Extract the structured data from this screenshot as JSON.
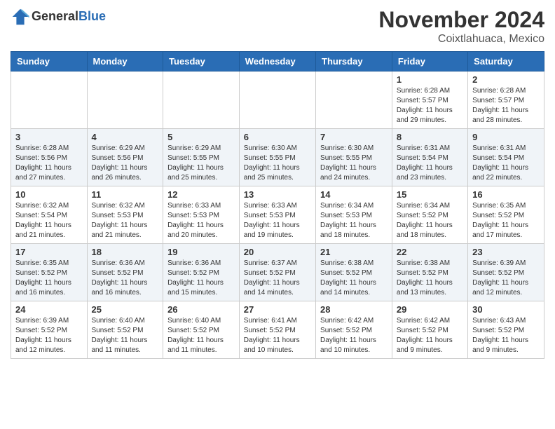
{
  "logo": {
    "general": "General",
    "blue": "Blue"
  },
  "title": "November 2024",
  "location": "Coixtlahuaca, Mexico",
  "headers": [
    "Sunday",
    "Monday",
    "Tuesday",
    "Wednesday",
    "Thursday",
    "Friday",
    "Saturday"
  ],
  "weeks": [
    [
      {
        "day": "",
        "info": ""
      },
      {
        "day": "",
        "info": ""
      },
      {
        "day": "",
        "info": ""
      },
      {
        "day": "",
        "info": ""
      },
      {
        "day": "",
        "info": ""
      },
      {
        "day": "1",
        "info": "Sunrise: 6:28 AM\nSunset: 5:57 PM\nDaylight: 11 hours and 29 minutes."
      },
      {
        "day": "2",
        "info": "Sunrise: 6:28 AM\nSunset: 5:57 PM\nDaylight: 11 hours and 28 minutes."
      }
    ],
    [
      {
        "day": "3",
        "info": "Sunrise: 6:28 AM\nSunset: 5:56 PM\nDaylight: 11 hours and 27 minutes."
      },
      {
        "day": "4",
        "info": "Sunrise: 6:29 AM\nSunset: 5:56 PM\nDaylight: 11 hours and 26 minutes."
      },
      {
        "day": "5",
        "info": "Sunrise: 6:29 AM\nSunset: 5:55 PM\nDaylight: 11 hours and 25 minutes."
      },
      {
        "day": "6",
        "info": "Sunrise: 6:30 AM\nSunset: 5:55 PM\nDaylight: 11 hours and 25 minutes."
      },
      {
        "day": "7",
        "info": "Sunrise: 6:30 AM\nSunset: 5:55 PM\nDaylight: 11 hours and 24 minutes."
      },
      {
        "day": "8",
        "info": "Sunrise: 6:31 AM\nSunset: 5:54 PM\nDaylight: 11 hours and 23 minutes."
      },
      {
        "day": "9",
        "info": "Sunrise: 6:31 AM\nSunset: 5:54 PM\nDaylight: 11 hours and 22 minutes."
      }
    ],
    [
      {
        "day": "10",
        "info": "Sunrise: 6:32 AM\nSunset: 5:54 PM\nDaylight: 11 hours and 21 minutes."
      },
      {
        "day": "11",
        "info": "Sunrise: 6:32 AM\nSunset: 5:53 PM\nDaylight: 11 hours and 21 minutes."
      },
      {
        "day": "12",
        "info": "Sunrise: 6:33 AM\nSunset: 5:53 PM\nDaylight: 11 hours and 20 minutes."
      },
      {
        "day": "13",
        "info": "Sunrise: 6:33 AM\nSunset: 5:53 PM\nDaylight: 11 hours and 19 minutes."
      },
      {
        "day": "14",
        "info": "Sunrise: 6:34 AM\nSunset: 5:53 PM\nDaylight: 11 hours and 18 minutes."
      },
      {
        "day": "15",
        "info": "Sunrise: 6:34 AM\nSunset: 5:52 PM\nDaylight: 11 hours and 18 minutes."
      },
      {
        "day": "16",
        "info": "Sunrise: 6:35 AM\nSunset: 5:52 PM\nDaylight: 11 hours and 17 minutes."
      }
    ],
    [
      {
        "day": "17",
        "info": "Sunrise: 6:35 AM\nSunset: 5:52 PM\nDaylight: 11 hours and 16 minutes."
      },
      {
        "day": "18",
        "info": "Sunrise: 6:36 AM\nSunset: 5:52 PM\nDaylight: 11 hours and 16 minutes."
      },
      {
        "day": "19",
        "info": "Sunrise: 6:36 AM\nSunset: 5:52 PM\nDaylight: 11 hours and 15 minutes."
      },
      {
        "day": "20",
        "info": "Sunrise: 6:37 AM\nSunset: 5:52 PM\nDaylight: 11 hours and 14 minutes."
      },
      {
        "day": "21",
        "info": "Sunrise: 6:38 AM\nSunset: 5:52 PM\nDaylight: 11 hours and 14 minutes."
      },
      {
        "day": "22",
        "info": "Sunrise: 6:38 AM\nSunset: 5:52 PM\nDaylight: 11 hours and 13 minutes."
      },
      {
        "day": "23",
        "info": "Sunrise: 6:39 AM\nSunset: 5:52 PM\nDaylight: 11 hours and 12 minutes."
      }
    ],
    [
      {
        "day": "24",
        "info": "Sunrise: 6:39 AM\nSunset: 5:52 PM\nDaylight: 11 hours and 12 minutes."
      },
      {
        "day": "25",
        "info": "Sunrise: 6:40 AM\nSunset: 5:52 PM\nDaylight: 11 hours and 11 minutes."
      },
      {
        "day": "26",
        "info": "Sunrise: 6:40 AM\nSunset: 5:52 PM\nDaylight: 11 hours and 11 minutes."
      },
      {
        "day": "27",
        "info": "Sunrise: 6:41 AM\nSunset: 5:52 PM\nDaylight: 11 hours and 10 minutes."
      },
      {
        "day": "28",
        "info": "Sunrise: 6:42 AM\nSunset: 5:52 PM\nDaylight: 11 hours and 10 minutes."
      },
      {
        "day": "29",
        "info": "Sunrise: 6:42 AM\nSunset: 5:52 PM\nDaylight: 11 hours and 9 minutes."
      },
      {
        "day": "30",
        "info": "Sunrise: 6:43 AM\nSunset: 5:52 PM\nDaylight: 11 hours and 9 minutes."
      }
    ]
  ]
}
